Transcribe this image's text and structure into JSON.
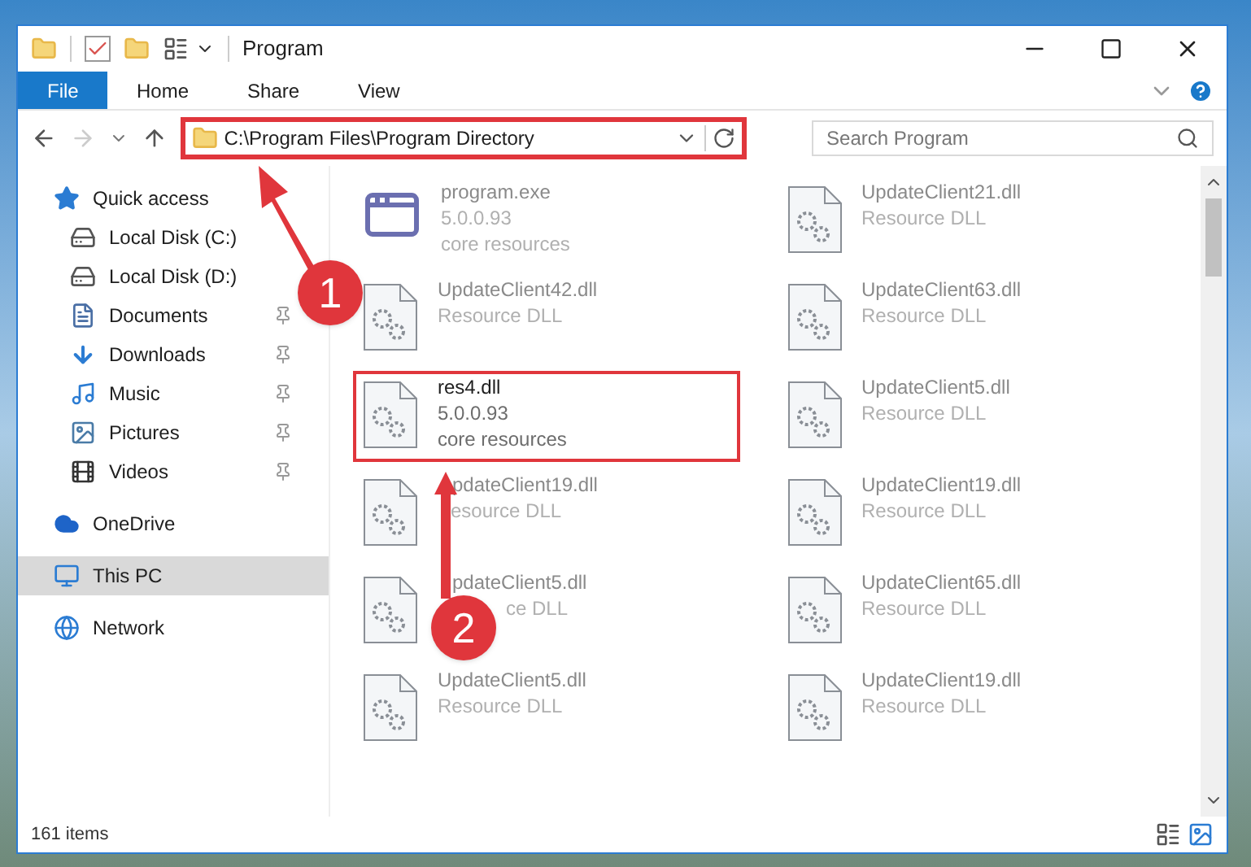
{
  "window": {
    "title": "Program"
  },
  "ribbon_tabs": [
    {
      "label": "File",
      "selected": true
    },
    {
      "label": "Home",
      "selected": false
    },
    {
      "label": "Share",
      "selected": false
    },
    {
      "label": "View",
      "selected": false
    }
  ],
  "address_bar": {
    "path": "C:\\Program Files\\Program Directory",
    "highlighted": true
  },
  "search": {
    "placeholder": "Search Program"
  },
  "navigation": [
    {
      "label": "Quick access",
      "kind": "star",
      "selected": false,
      "children": [
        {
          "label": "Local Disk (C:)",
          "kind": "drive",
          "pinned": false,
          "selected": false
        },
        {
          "label": "Local Disk (D:)",
          "kind": "drive",
          "pinned": false,
          "selected": false
        },
        {
          "label": "Documents",
          "kind": "document",
          "pinned": true,
          "selected": false
        },
        {
          "label": "Downloads",
          "kind": "download",
          "pinned": true,
          "selected": false
        },
        {
          "label": "Music",
          "kind": "music",
          "pinned": true,
          "selected": false
        },
        {
          "label": "Pictures",
          "kind": "picture",
          "pinned": true,
          "selected": false
        },
        {
          "label": "Videos",
          "kind": "video",
          "pinned": true,
          "selected": false
        }
      ]
    },
    {
      "label": "OneDrive",
      "kind": "cloud",
      "selected": false
    },
    {
      "label": "This PC",
      "kind": "pc",
      "selected": true
    },
    {
      "label": "Network",
      "kind": "network",
      "selected": false
    }
  ],
  "files": [
    {
      "name": "program.exe",
      "kind": "exe",
      "details": [
        "5.0.0.93",
        "core resources"
      ],
      "highlighted": false,
      "blurred": true
    },
    {
      "name": "UpdateClient21.dll",
      "kind": "dll",
      "details": [
        "Resource DLL"
      ],
      "highlighted": false,
      "blurred": true
    },
    {
      "name": "UpdateClient42.dll",
      "kind": "dll",
      "details": [
        "Resource DLL"
      ],
      "highlighted": false,
      "blurred": true
    },
    {
      "name": "UpdateClient63.dll",
      "kind": "dll",
      "details": [
        "Resource DLL"
      ],
      "highlighted": false,
      "blurred": true
    },
    {
      "name": "res4.dll",
      "kind": "dll",
      "details": [
        "5.0.0.93",
        "core resources"
      ],
      "highlighted": true,
      "blurred": false
    },
    {
      "name": "UpdateClient5.dll",
      "kind": "dll",
      "details": [
        "Resource DLL"
      ],
      "highlighted": false,
      "blurred": true
    },
    {
      "name": "pdateClient19.dll",
      "kind": "dll",
      "details": [
        "esource DLL"
      ],
      "highlighted": false,
      "blurred": true
    },
    {
      "name": "UpdateClient19.dll",
      "kind": "dll",
      "details": [
        "Resource DLL"
      ],
      "highlighted": false,
      "blurred": true
    },
    {
      "name": "pdateClient5.dll",
      "kind": "dll",
      "details": [
        "ce DLL"
      ],
      "highlighted": false,
      "blurred": true
    },
    {
      "name": "UpdateClient65.dll",
      "kind": "dll",
      "details": [
        "Resource DLL"
      ],
      "highlighted": false,
      "blurred": true
    },
    {
      "name": "UpdateClient5.dll",
      "kind": "dll",
      "details": [
        "Resource DLL"
      ],
      "highlighted": false,
      "blurred": true
    },
    {
      "name": "UpdateClient19.dll",
      "kind": "dll",
      "details": [
        "Resource DLL"
      ],
      "highlighted": false,
      "blurred": true
    }
  ],
  "annotations": [
    {
      "label": "1"
    },
    {
      "label": "2"
    }
  ],
  "status_bar": {
    "item_count": "161 items"
  }
}
